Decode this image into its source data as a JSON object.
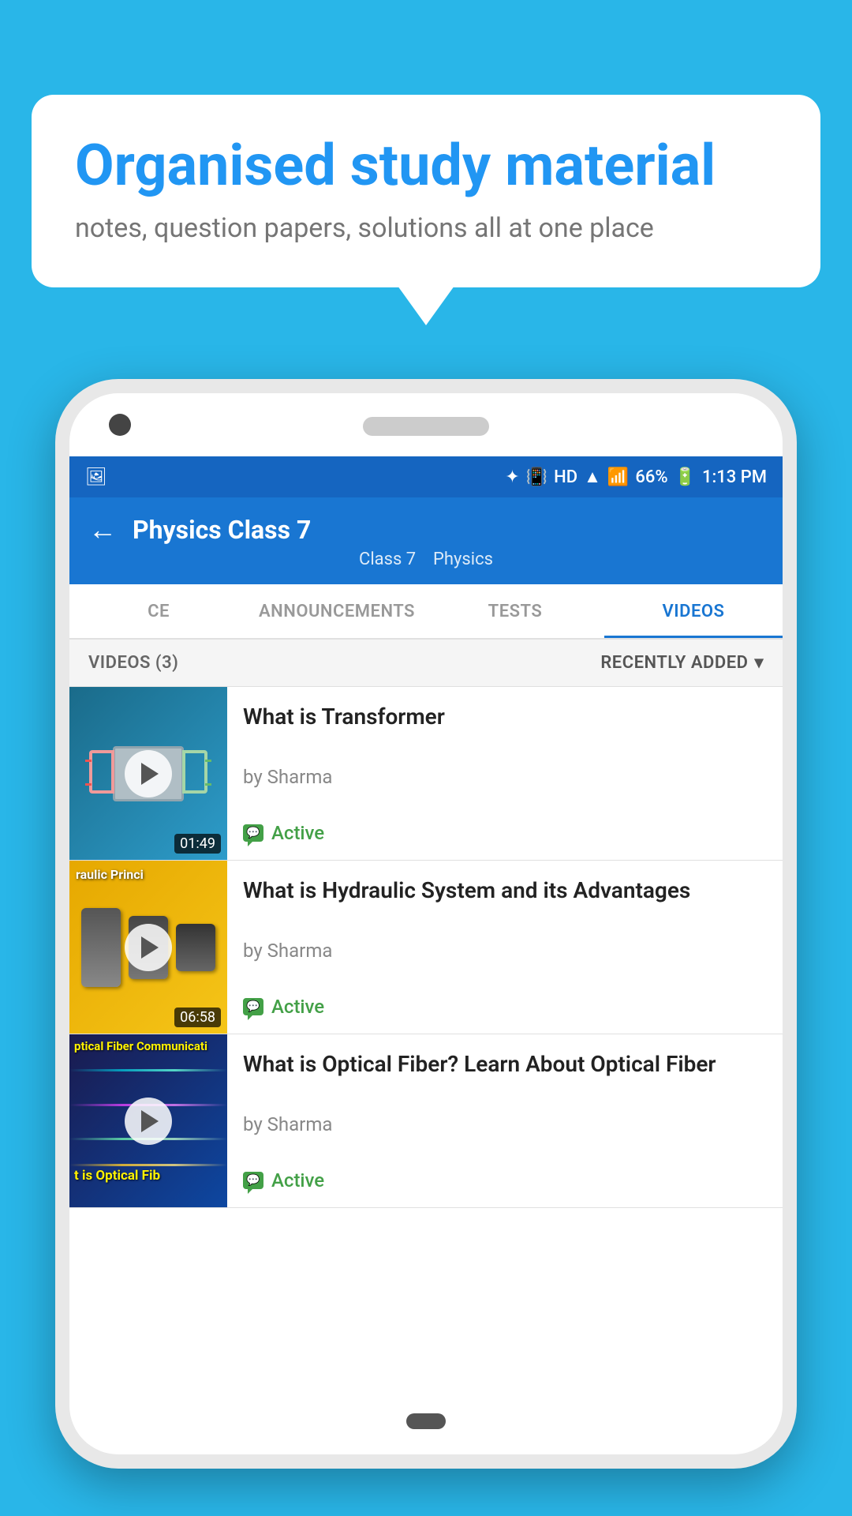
{
  "background_color": "#29b6e8",
  "bubble": {
    "title": "Organised study material",
    "subtitle": "notes, question papers, solutions all at one place"
  },
  "status_bar": {
    "time": "1:13 PM",
    "battery": "66%",
    "signal": "HD"
  },
  "app_bar": {
    "title": "Physics Class 7",
    "subtitle_class": "Class 7",
    "subtitle_subject": "Physics",
    "back_label": "←"
  },
  "tabs": [
    {
      "id": "ce",
      "label": "CE",
      "active": false
    },
    {
      "id": "announcements",
      "label": "ANNOUNCEMENTS",
      "active": false
    },
    {
      "id": "tests",
      "label": "TESTS",
      "active": false
    },
    {
      "id": "videos",
      "label": "VIDEOS",
      "active": true
    }
  ],
  "videos_header": {
    "count_label": "VIDEOS (3)",
    "sort_label": "RECENTLY ADDED",
    "sort_icon": "▾"
  },
  "videos": [
    {
      "id": "v1",
      "title": "What is  Transformer",
      "author": "by Sharma",
      "status": "Active",
      "duration": "01:49",
      "thumb_type": "transformer"
    },
    {
      "id": "v2",
      "title": "What is Hydraulic System and its Advantages",
      "author": "by Sharma",
      "status": "Active",
      "duration": "06:58",
      "thumb_type": "hydraulic",
      "thumb_text": "raulic Princi"
    },
    {
      "id": "v3",
      "title": "What is Optical Fiber? Learn About Optical Fiber",
      "author": "by Sharma",
      "status": "Active",
      "duration": "",
      "thumb_type": "optical",
      "thumb_line1": "ptical Fiber Communicati",
      "thumb_line2": "t is Optical Fib"
    }
  ]
}
